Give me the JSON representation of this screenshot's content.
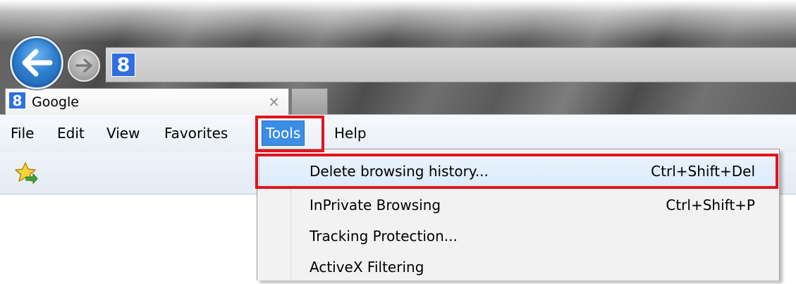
{
  "tab": {
    "title": "Google",
    "favicon": "8",
    "close": "×"
  },
  "address": {
    "favicon": "8"
  },
  "icons": {
    "back": "back-arrow-icon",
    "forward": "forward-arrow-icon",
    "favorites": "add-to-favorites-icon"
  },
  "menu": {
    "items": [
      "File",
      "Edit",
      "View",
      "Favorites",
      "Tools",
      "Help"
    ],
    "active": "Tools"
  },
  "tools_menu": {
    "items": [
      {
        "label": "Delete browsing history...",
        "shortcut": "Ctrl+Shift+Del",
        "highlighted": true
      },
      {
        "label": "InPrivate Browsing",
        "shortcut": "Ctrl+Shift+P",
        "highlighted": false
      },
      {
        "label": "Tracking Protection...",
        "shortcut": "",
        "highlighted": false
      },
      {
        "label": "ActiveX Filtering",
        "shortcut": "",
        "highlighted": false
      }
    ]
  },
  "colors": {
    "accent": "#3a8ee6",
    "annotation": "#e2141b",
    "google_blue": "#2f6fe0"
  }
}
